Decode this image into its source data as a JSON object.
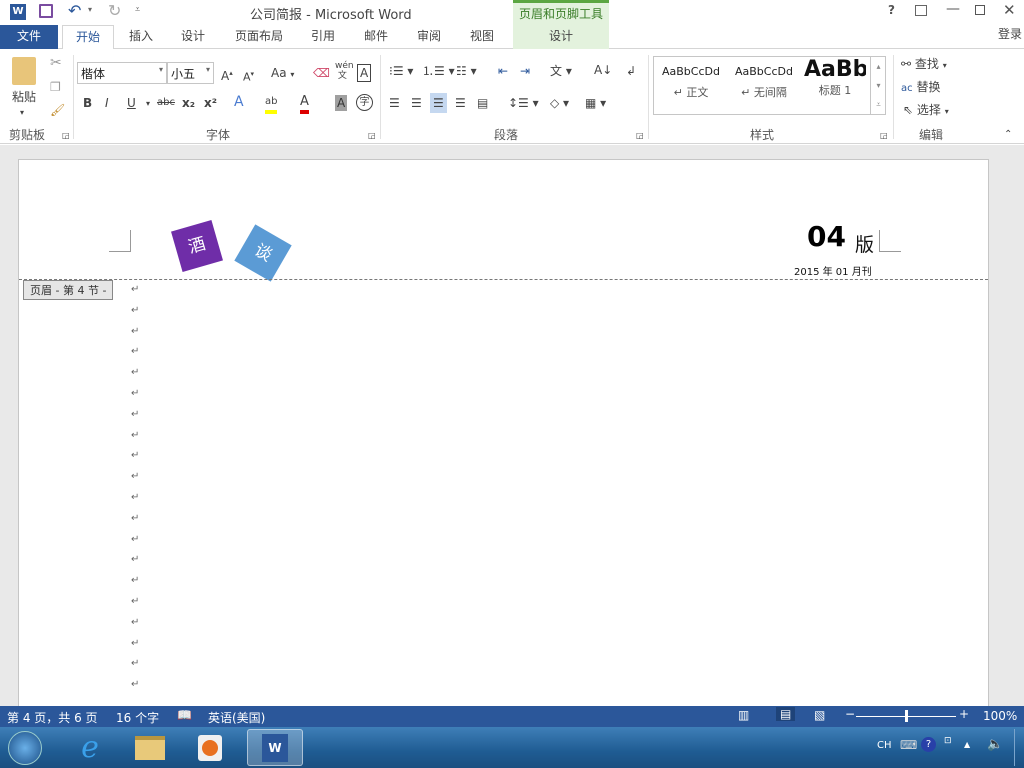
{
  "window": {
    "title": "公司简报 - Microsoft Word",
    "help": "?",
    "contextual_group": "页眉和页脚工具",
    "signin": "登录"
  },
  "tabs": [
    {
      "label": "文件"
    },
    {
      "label": "开始"
    },
    {
      "label": "插入"
    },
    {
      "label": "设计"
    },
    {
      "label": "页面布局"
    },
    {
      "label": "引用"
    },
    {
      "label": "邮件"
    },
    {
      "label": "审阅"
    },
    {
      "label": "视图"
    },
    {
      "label": "设计"
    }
  ],
  "ribbon": {
    "clipboard": {
      "label": "剪贴板",
      "paste": "粘贴"
    },
    "font": {
      "label": "字体",
      "font_name": "楷体",
      "font_size": "小五",
      "change_case": "Aa",
      "bold": "B",
      "italic": "I",
      "underline": "U",
      "strike": "abc",
      "sub": "x₂",
      "sup": "x²",
      "phonetic": "wén",
      "char_border": "A",
      "char_shading": "A",
      "enclose": "字"
    },
    "paragraph": {
      "label": "段落"
    },
    "styles": {
      "label": "样式",
      "items": [
        {
          "preview": "AaBbCcDd",
          "name": "正文"
        },
        {
          "preview": "AaBbCcDd",
          "name": "无间隔"
        },
        {
          "preview": "AaBb",
          "name": "标题 1"
        }
      ]
    },
    "editing": {
      "label": "编辑",
      "find": "查找",
      "replace": "替换",
      "select": "选择"
    }
  },
  "document": {
    "logo_chars": [
      "酒",
      "谈"
    ],
    "issue_number": "04",
    "issue_suffix": "版",
    "date": "2015 年 01 月刊",
    "header_tag": "页眉 - 第 4 节 -",
    "para_mark": "↵"
  },
  "status": {
    "page": "第 4 页，共 6 页",
    "words": "16 个字",
    "language": "英语(美国)",
    "zoom": "100%",
    "zoom_percent": 100
  },
  "taskbar": {
    "tray_lang": "CH"
  },
  "colors": {
    "accent": "#2b579a",
    "contextual": "#e3f2dd",
    "purple": "#6f2da8",
    "blue": "#5b9bd5"
  }
}
